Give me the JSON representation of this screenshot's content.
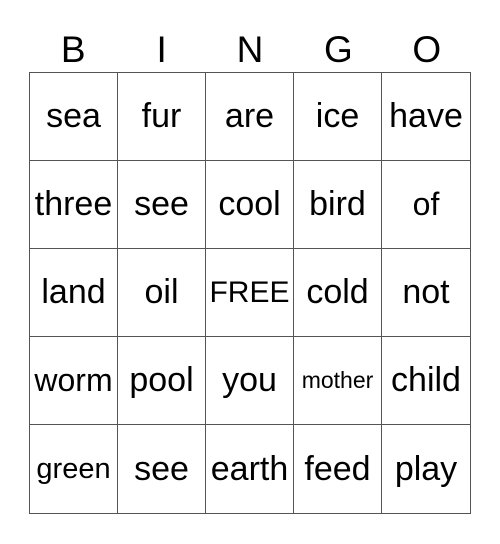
{
  "header": [
    "B",
    "I",
    "N",
    "G",
    "O"
  ],
  "cells": [
    [
      "sea",
      "fur",
      "are",
      "ice",
      "have"
    ],
    [
      "three",
      "see",
      "cool",
      "bird",
      "of"
    ],
    [
      "land",
      "oil",
      "FREE",
      "cold",
      "not"
    ],
    [
      "worm",
      "pool",
      "you",
      "mother",
      "child"
    ],
    [
      "green",
      "see",
      "earth",
      "feed",
      "play"
    ]
  ]
}
